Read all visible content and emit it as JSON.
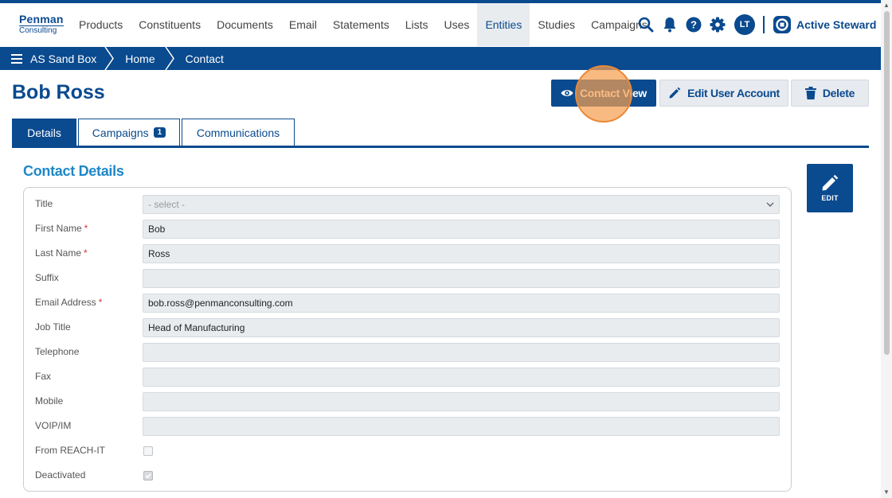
{
  "logo": {
    "line1": "Penman",
    "line2": "Consulting"
  },
  "nav": {
    "links": [
      "Products",
      "Constituents",
      "Documents",
      "Email",
      "Statements",
      "Lists",
      "Uses",
      "Entities",
      "Studies",
      "Campaigns"
    ],
    "active": "Entities",
    "user_initials": "LT",
    "brand": "Active Steward"
  },
  "breadcrumb": {
    "items": [
      "AS Sand Box",
      "Home",
      "Contact"
    ]
  },
  "page": {
    "title": "Bob Ross"
  },
  "actions": {
    "contact_view": "Contact View",
    "edit_user_account": "Edit User Account",
    "delete": "Delete"
  },
  "tabs": [
    {
      "label": "Details",
      "active": true
    },
    {
      "label": "Campaigns",
      "badge": "1"
    },
    {
      "label": "Communications"
    }
  ],
  "section": {
    "title": "Contact Details",
    "edit_label": "EDIT"
  },
  "form": {
    "fields": [
      {
        "label": "Title",
        "type": "select",
        "value": "",
        "placeholder": "- select -",
        "required": false
      },
      {
        "label": "First Name",
        "type": "text",
        "value": "Bob",
        "required": true
      },
      {
        "label": "Last Name",
        "type": "text",
        "value": "Ross",
        "required": true
      },
      {
        "label": "Suffix",
        "type": "text",
        "value": "",
        "required": false
      },
      {
        "label": "Email Address",
        "type": "text",
        "value": "bob.ross@penmanconsulting.com",
        "required": true
      },
      {
        "label": "Job Title",
        "type": "text",
        "value": "Head of Manufacturing",
        "required": false
      },
      {
        "label": "Telephone",
        "type": "text",
        "value": "",
        "required": false
      },
      {
        "label": "Fax",
        "type": "text",
        "value": "",
        "required": false
      },
      {
        "label": "Mobile",
        "type": "text",
        "value": "",
        "required": false
      },
      {
        "label": "VOIP/IM",
        "type": "text",
        "value": "",
        "required": false
      },
      {
        "label": "From REACH-IT",
        "type": "checkbox",
        "checked": false
      },
      {
        "label": "Deactivated",
        "type": "checkbox",
        "checked": true
      }
    ],
    "required_marker": "*"
  },
  "colors": {
    "primary": "#0a4a8f",
    "section_title": "#1e88c8",
    "highlight": "#f5a050"
  }
}
